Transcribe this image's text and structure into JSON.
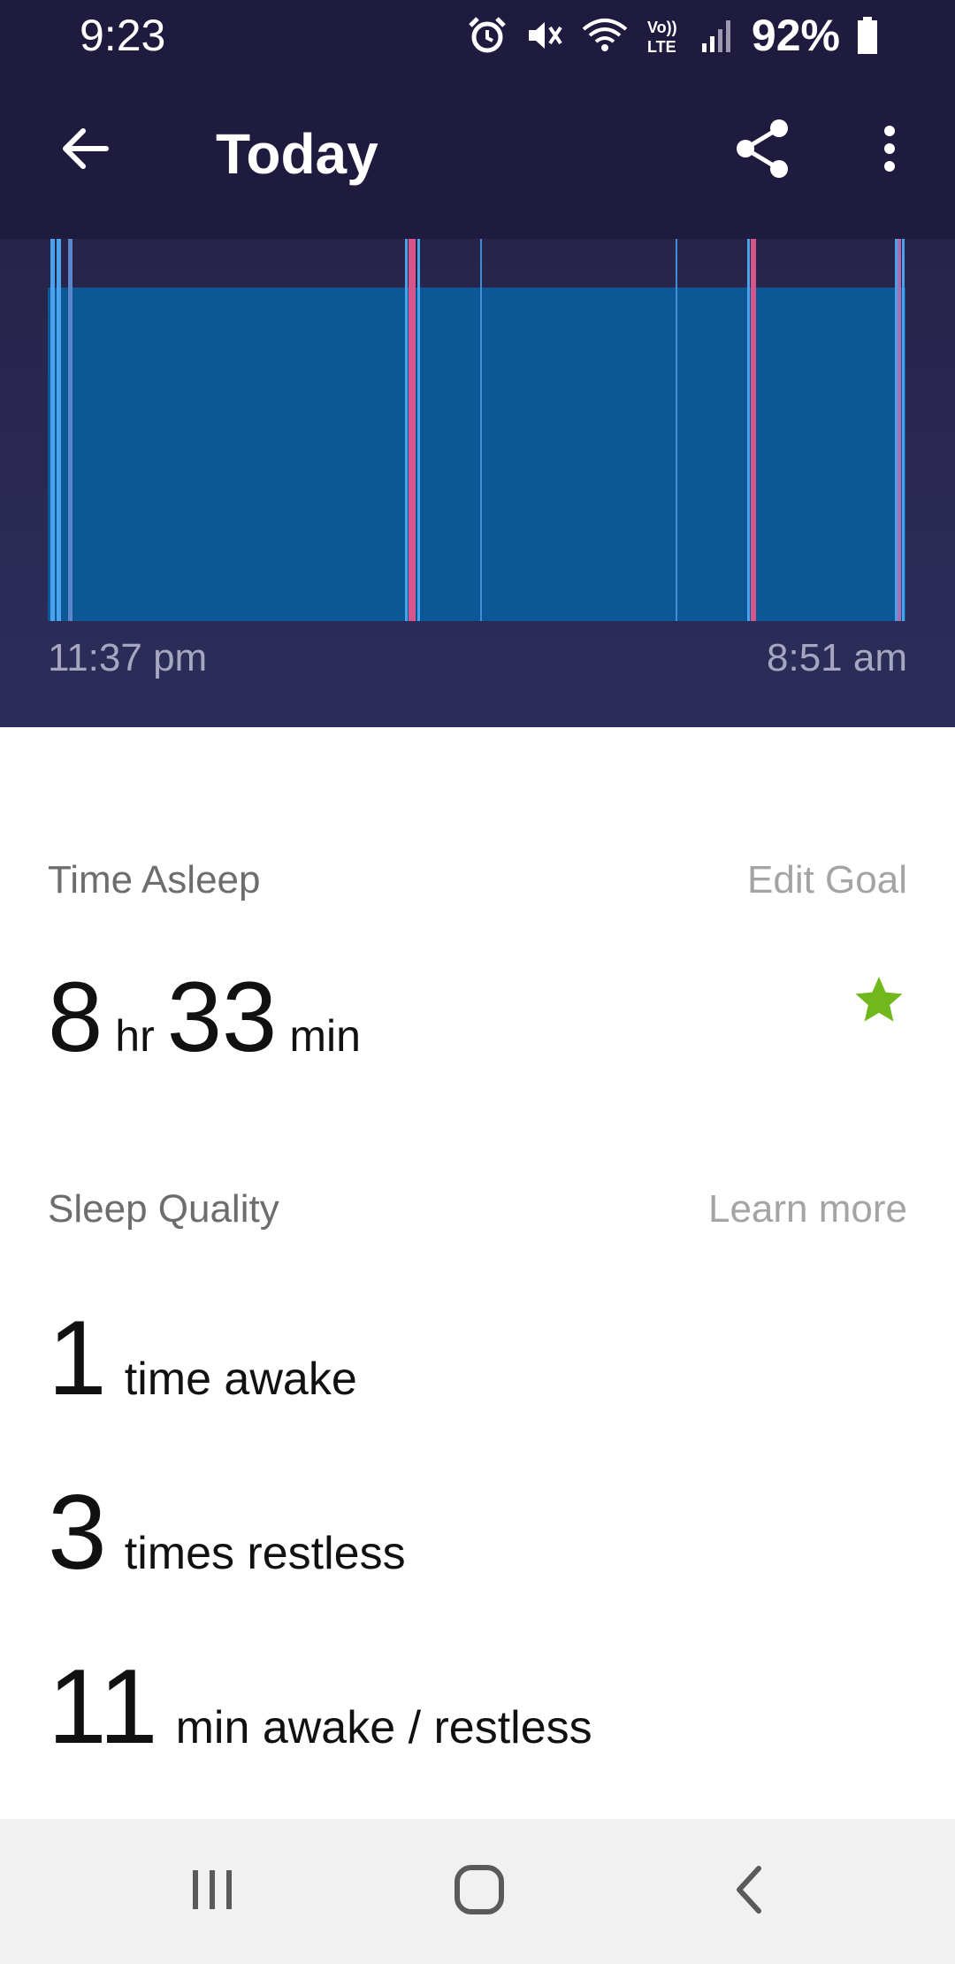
{
  "status_bar": {
    "time": "9:23",
    "battery": "92%",
    "icons": [
      "alarm-icon",
      "mute-icon",
      "wifi-icon",
      "volte-icon",
      "signal-icon",
      "battery-icon"
    ]
  },
  "app_bar": {
    "title": "Today",
    "icons": [
      "back-arrow-icon",
      "share-icon",
      "more-vert-icon"
    ]
  },
  "chart": {
    "start_label": "11:37 pm",
    "end_label": "8:51 am"
  },
  "chart_data": {
    "type": "timeline",
    "title": "",
    "x_start": "11:37 pm",
    "x_end": "8:51 am",
    "states": [
      "asleep",
      "restless",
      "awake"
    ],
    "colors": {
      "asleep": "#0c5795",
      "restless": "#4a9fe3",
      "awake": "#d6568c"
    }
  },
  "time_asleep": {
    "title": "Time Asleep",
    "link": "Edit Goal",
    "hours": "8",
    "hours_unit": "hr",
    "minutes": "33",
    "minutes_unit": "min",
    "goal_met_icon": "star-icon",
    "star_color": "#71b81d"
  },
  "sleep_quality": {
    "title": "Sleep Quality",
    "link": "Learn more",
    "stats": [
      {
        "value": "1",
        "label": "time awake"
      },
      {
        "value": "3",
        "label": "times restless"
      },
      {
        "value": "11",
        "label": "min awake / restless"
      }
    ]
  },
  "nav_bar": {
    "icons": [
      "recents-icon",
      "home-icon",
      "back-icon"
    ]
  }
}
